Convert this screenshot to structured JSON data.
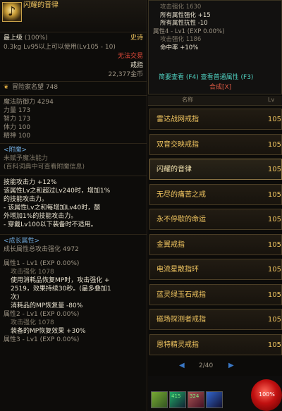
{
  "item": {
    "name": "闪耀的音律",
    "level": "最上级",
    "durability": "(100%)",
    "rarity": "史诗",
    "weight": "0.3kg",
    "req": "Lv95以上可以使用(Lv105 - 10)",
    "trade": "无法交易",
    "type": "戒指",
    "price": "22,377金币"
  },
  "fame": {
    "label": "冒险家名望",
    "value": "748"
  },
  "stats": [
    {
      "label": "魔法防御力",
      "value": "4294"
    },
    {
      "label": "力量",
      "value": "173"
    },
    {
      "label": "智力",
      "value": "173"
    },
    {
      "label": "体力",
      "value": "100"
    },
    {
      "label": "精神",
      "value": "100"
    }
  ],
  "enchant": {
    "title": "<附魔>",
    "line1": "未赋予魔法能力",
    "line2": "(百科词典中可查看附魔信息)"
  },
  "effects": {
    "line1": "技能攻击力 +12%",
    "line2": "该属性Lv之和超过Lv240时，增加1%",
    "line3": "的技能攻击力。",
    "line4": "- 该属性Lv之和每增加Lv40时，额",
    "line5": "外增加1%的技能攻击力。",
    "line6": "- 穿戴Lv100以下装备时不适用。"
  },
  "growth": {
    "title": "<成长属性>",
    "total_label": "成长属性总攻击强化",
    "total_value": "4972",
    "attr1": "属性1 - Lv1 (EXP 0.00%)",
    "attr1_atk": "攻击强化 1078",
    "attr1_desc1": "使用消耗品恢复MP时，攻击强化 +",
    "attr1_desc2": "2519，效果持续30秒。(最多叠加1",
    "attr1_desc3": "次)",
    "attr1_extra": "消耗品的MP恢复量 -80%",
    "attr2": "属性2 - Lv1 (EXP 0.00%)",
    "attr2_atk": "攻击强化 1078",
    "attr2_extra": "装备的MP恢复效果 +30%",
    "attr3": "属性3 - Lv1 (EXP 0.00%)"
  },
  "mini_tooltip": {
    "lines": [
      "攻击强化 1630",
      "所有属性强化 +15",
      "所有属性抗性 -10",
      "属性4 - Lv1 (EXP 0.00%)",
      "攻击强化 1186",
      "命中率 +10%"
    ],
    "links": "简要查看 (F4) 查看普通属性 (F3)",
    "compose": "合成[X]"
  },
  "list": {
    "header_name": "名称",
    "header_lv": "Lv",
    "items": [
      {
        "name": "雷达战网戒指",
        "lv": "105"
      },
      {
        "name": "双音交映戒指",
        "lv": "105"
      },
      {
        "name": "闪耀的音律",
        "lv": "105"
      },
      {
        "name": "无尽的痛苦之戒",
        "lv": "105"
      },
      {
        "name": "永不停歇的命运",
        "lv": "105"
      },
      {
        "name": "金翼戒指",
        "lv": "105"
      },
      {
        "name": "电流星散指环",
        "lv": "105"
      },
      {
        "name": "蓝灵绿玉石戒指",
        "lv": "105"
      },
      {
        "name": "磁场探测者戒指",
        "lv": "105"
      },
      {
        "name": "恩特精灵戒指",
        "lv": "105"
      }
    ],
    "page": "2/40"
  },
  "hud": {
    "hp_percent": "100%",
    "slot1": "415",
    "slot2": "324"
  }
}
